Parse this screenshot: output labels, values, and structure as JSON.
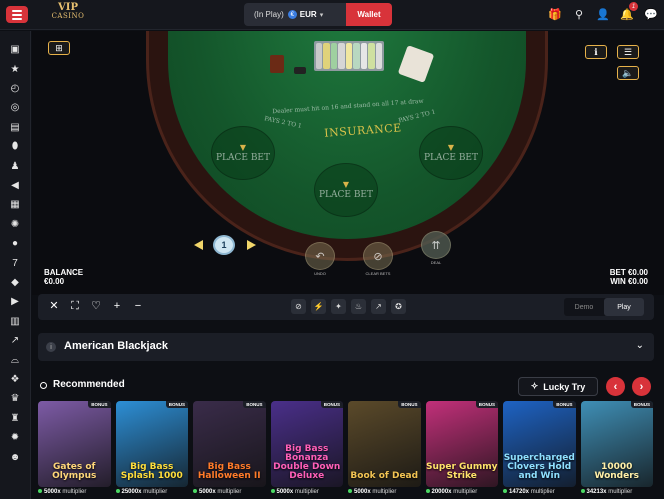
{
  "header": {
    "logo_line1": "VIP",
    "logo_line2": "CASINO",
    "inplay_label": "(In Play)",
    "currency_symbol": "€",
    "currency": "EUR",
    "wallet_label": "Wallet",
    "notification_count": "1"
  },
  "sidebar": {
    "icons": [
      "casino-icon",
      "star-icon",
      "history-icon",
      "target-icon",
      "ticket-icon",
      "egg-icon",
      "user-icon",
      "megaphone-icon",
      "slot-icon",
      "wheel-icon",
      "chip-icon",
      "seven-icon",
      "fish-icon",
      "play-icon",
      "bingo-icon",
      "crash-icon",
      "bowl-icon",
      "gift-icon",
      "trophy-icon",
      "trophy-cup-icon",
      "wheel2-icon",
      "help-icon"
    ]
  },
  "table": {
    "rule_text": "Dealer must hit on 16 and stand on all 17 at draw",
    "payout_left": "PAYS 2 TO 1",
    "payout_right": "PAYS 2 TO 1",
    "insurance": "INSURANCE",
    "place_bet": [
      "PLACE BET",
      "PLACE BET",
      "PLACE BET"
    ],
    "chip_value": "1",
    "undo_label": "UNDO",
    "clear_label": "CLEAR BETS",
    "deal_label": "DEAL"
  },
  "balance": {
    "balance_label": "BALANCE",
    "balance_value": "€0.00",
    "bet_label": "BET €0.00",
    "win_label": "WIN €0.00"
  },
  "controls": {
    "demo_label": "Demo",
    "play_label": "Play",
    "active_mode": "Play"
  },
  "game": {
    "title": "American Blackjack"
  },
  "recommended": {
    "title": "Recommended",
    "lucky_label": "Lucky Try",
    "bonus_tag": "BONUS",
    "multiplier_suffix": "multiplier",
    "games": [
      {
        "name": "Gates of Olympus",
        "multiplier": "5000x",
        "bg": "#7d5ba6",
        "fg": "#ffd77a"
      },
      {
        "name": "Big Bass Splash 1000",
        "multiplier": "25000x",
        "bg": "#2d8fd6",
        "fg": "#ffde3b"
      },
      {
        "name": "Big Bass Halloween II",
        "multiplier": "5000x",
        "bg": "#3a2c4a",
        "fg": "#ff7b2a"
      },
      {
        "name": "Big Bass Bonanza Double Down Deluxe",
        "multiplier": "5000x",
        "bg": "#4a2f8a",
        "fg": "#ff5fb8"
      },
      {
        "name": "Book of Dead",
        "multiplier": "5000x",
        "bg": "#5b4a2a",
        "fg": "#f3c453"
      },
      {
        "name": "Super Gummy Strike",
        "multiplier": "20000x",
        "bg": "#c2307a",
        "fg": "#ffe36a"
      },
      {
        "name": "Supercharged Clovers Hold and Win",
        "multiplier": "14720x",
        "bg": "#1e63c4",
        "fg": "#8fe0ff"
      },
      {
        "name": "10000 Wonders",
        "multiplier": "34213x",
        "bg": "#3f8fb6",
        "fg": "#fff0a8"
      }
    ]
  },
  "colors": {
    "accent": "#d8333a",
    "felt": "#1f7a3e",
    "gold": "#e7b24a"
  }
}
